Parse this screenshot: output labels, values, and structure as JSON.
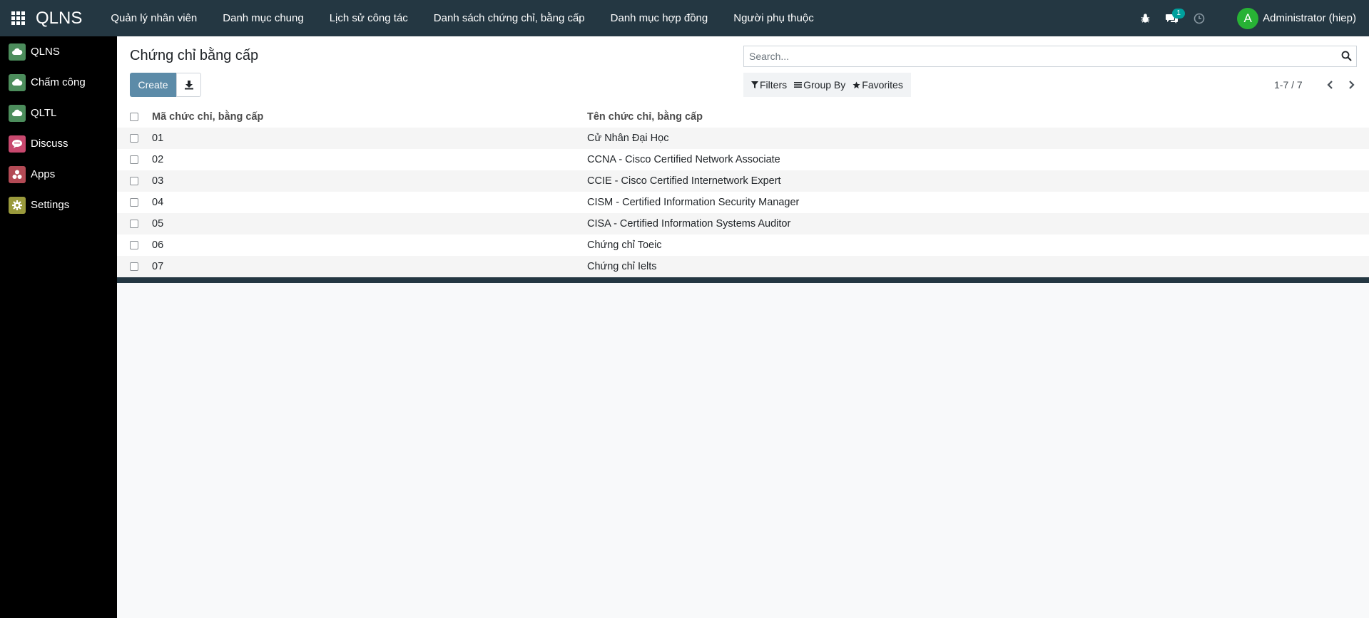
{
  "navbar": {
    "brand": "QLNS",
    "menu": [
      "Quản lý nhân viên",
      "Danh mục chung",
      "Lịch sử công tác",
      "Danh sách chứng chỉ, bằng cấp",
      "Danh mục hợp đồng",
      "Người phụ thuộc"
    ],
    "messages_count": "1",
    "user": {
      "initial": "A",
      "name": "Administrator (hiep)"
    }
  },
  "sidebar": {
    "items": [
      {
        "label": "QLNS",
        "icon": "cloud-icon",
        "color": "#4c8d5c"
      },
      {
        "label": "Chấm công",
        "icon": "cloud-icon",
        "color": "#4c8d5c"
      },
      {
        "label": "QLTL",
        "icon": "cloud-icon",
        "color": "#4c8d5c"
      },
      {
        "label": "Discuss",
        "icon": "chat-icon",
        "color": "#c8486e"
      },
      {
        "label": "Apps",
        "icon": "apps-icon",
        "color": "#b34a55"
      },
      {
        "label": "Settings",
        "icon": "gear-icon",
        "color": "#9a9a3c"
      }
    ]
  },
  "control_panel": {
    "title": "Chứng chỉ bằng cấp",
    "create_label": "Create",
    "search_placeholder": "Search...",
    "filters_label": "Filters",
    "group_by_label": "Group By",
    "favorites_label": "Favorites",
    "pager": "1-7 / 7"
  },
  "list": {
    "columns": [
      "Mã chức chỉ, bằng cấp",
      "Tên chức chỉ, bằng cấp"
    ],
    "rows": [
      {
        "code": "01",
        "name": "Cử Nhân Đại Học"
      },
      {
        "code": "02",
        "name": "CCNA - Cisco Certified Network Associate"
      },
      {
        "code": "03",
        "name": "CCIE - Cisco Certified Internetwork Expert"
      },
      {
        "code": "04",
        "name": "CISM - Certified Information Security Manager"
      },
      {
        "code": "05",
        "name": "CISA - Certified Information Systems Auditor"
      },
      {
        "code": "06",
        "name": "Chứng chỉ Toeic"
      },
      {
        "code": "07",
        "name": "Chứng chỉ Ielts"
      }
    ]
  },
  "colors": {
    "navbar": "#243742",
    "sidebar": "#000000",
    "primary_button": "#5c8ba8",
    "badge": "#00a09d",
    "avatar": "#28b235"
  }
}
